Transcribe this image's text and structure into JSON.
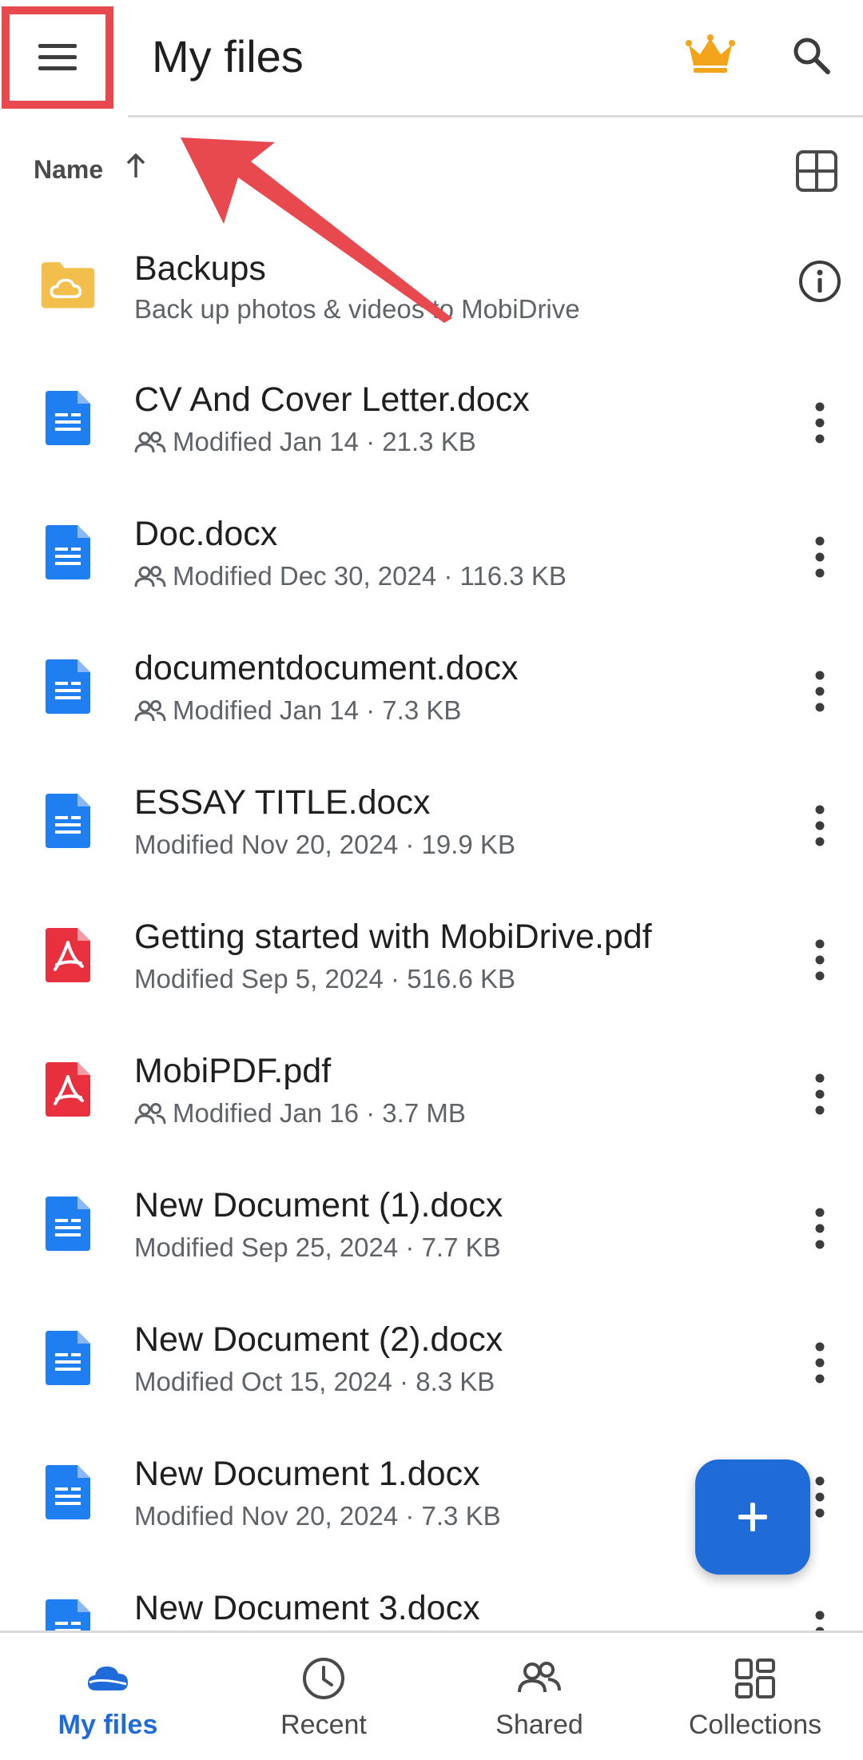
{
  "header": {
    "title": "My files"
  },
  "sort": {
    "label": "Name"
  },
  "colors": {
    "accent": "#1f6bd8",
    "doc_blue": "#1f7ef0",
    "pdf_red": "#e8303f",
    "folder_yellow": "#f2bf4c",
    "annotation_red": "#e8494e"
  },
  "backup": {
    "name": "Backups",
    "description": "Back up photos & videos to MobiDrive"
  },
  "files": [
    {
      "name": "CV And Cover Letter.docx",
      "meta": "Modified Jan 14 · 21.3 KB",
      "type": "doc",
      "shared": true
    },
    {
      "name": "Doc.docx",
      "meta": "Modified Dec 30, 2024 · 116.3 KB",
      "type": "doc",
      "shared": true
    },
    {
      "name": "documentdocument.docx",
      "meta": "Modified Jan 14 · 7.3 KB",
      "type": "doc",
      "shared": true
    },
    {
      "name": "ESSAY TITLE.docx",
      "meta": "Modified Nov 20, 2024 · 19.9 KB",
      "type": "doc",
      "shared": false
    },
    {
      "name": "Getting started with MobiDrive.pdf",
      "meta": "Modified Sep 5, 2024 · 516.6 KB",
      "type": "pdf",
      "shared": false
    },
    {
      "name": "MobiPDF.pdf",
      "meta": "Modified Jan 16 · 3.7 MB",
      "type": "pdf",
      "shared": true
    },
    {
      "name": "New Document (1).docx",
      "meta": "Modified Sep 25, 2024 · 7.7 KB",
      "type": "doc",
      "shared": false
    },
    {
      "name": "New Document (2).docx",
      "meta": "Modified Oct 15, 2024 · 8.3 KB",
      "type": "doc",
      "shared": false
    },
    {
      "name": "New Document 1.docx",
      "meta": "Modified Nov 20, 2024 · 7.3 KB",
      "type": "doc",
      "shared": false
    },
    {
      "name": "New Document 3.docx",
      "meta": "",
      "type": "doc",
      "shared": false
    }
  ],
  "nav": [
    {
      "label": "My files",
      "icon": "cloud-icon",
      "active": true
    },
    {
      "label": "Recent",
      "icon": "clock-icon",
      "active": false
    },
    {
      "label": "Shared",
      "icon": "people-icon",
      "active": false
    },
    {
      "label": "Collections",
      "icon": "collections-icon",
      "active": false
    }
  ]
}
